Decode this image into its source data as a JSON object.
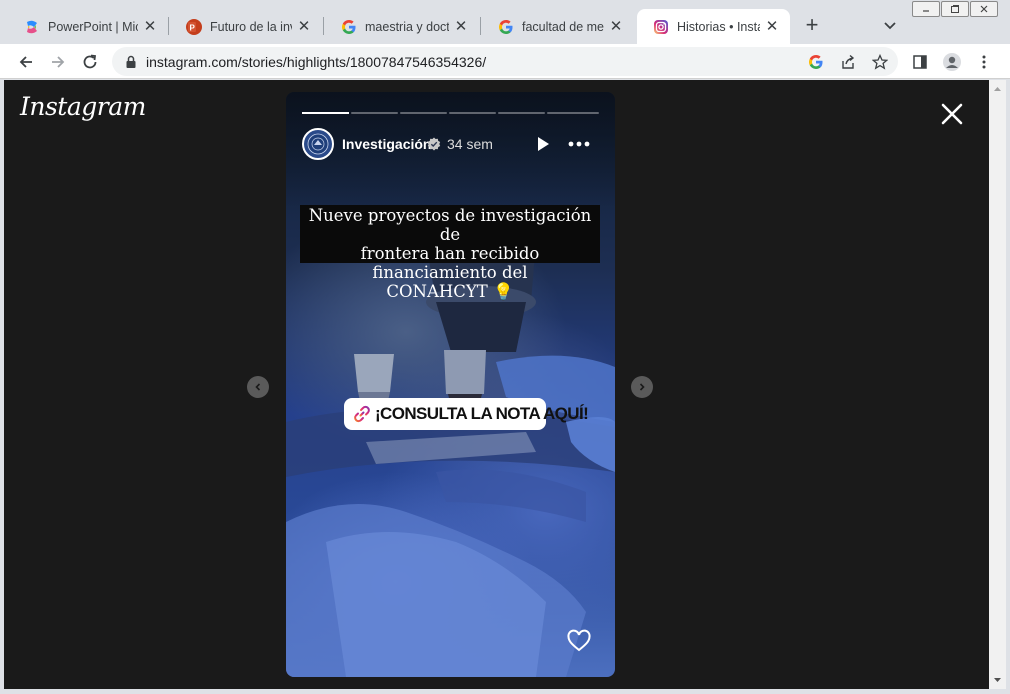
{
  "browser": {
    "tabs": [
      {
        "title": "PowerPoint | Micr",
        "favicon": "copilot-favicon",
        "active": false
      },
      {
        "title": "Futuro de la inve",
        "favicon": "powerpoint-favicon",
        "active": false
      },
      {
        "title": "maestria y doctor",
        "favicon": "google-favicon",
        "active": false
      },
      {
        "title": "facultad de medi",
        "favicon": "google-favicon",
        "active": false
      },
      {
        "title": "Historias • Instag",
        "favicon": "instagram-favicon",
        "active": true
      }
    ],
    "new_tab": "+",
    "url": "instagram.com/stories/highlights/18007847546354326/",
    "colors": {
      "tabstrip": "#dee1e6",
      "omnibox": "#f1f3f4",
      "content_bg": "#1a1a1a"
    }
  },
  "page": {
    "logo": "Instagram",
    "story": {
      "username": "Investigación",
      "verified": true,
      "time": "34 sem",
      "headline": "Nueve proyectos de investigación de\nfrontera han recibido financiamiento del\nCONAHCYT 💡",
      "link_sticker": "¡CONSULTA LA NOTA AQUÍ!",
      "progress_segments": 6,
      "current_segment": 1,
      "current_segment_progress": 1.0
    },
    "icons": [
      "close-icon",
      "play-icon",
      "more-icon",
      "heart-icon",
      "link-icon",
      "verified-icon",
      "prev-arrow-icon",
      "next-arrow-icon"
    ]
  }
}
